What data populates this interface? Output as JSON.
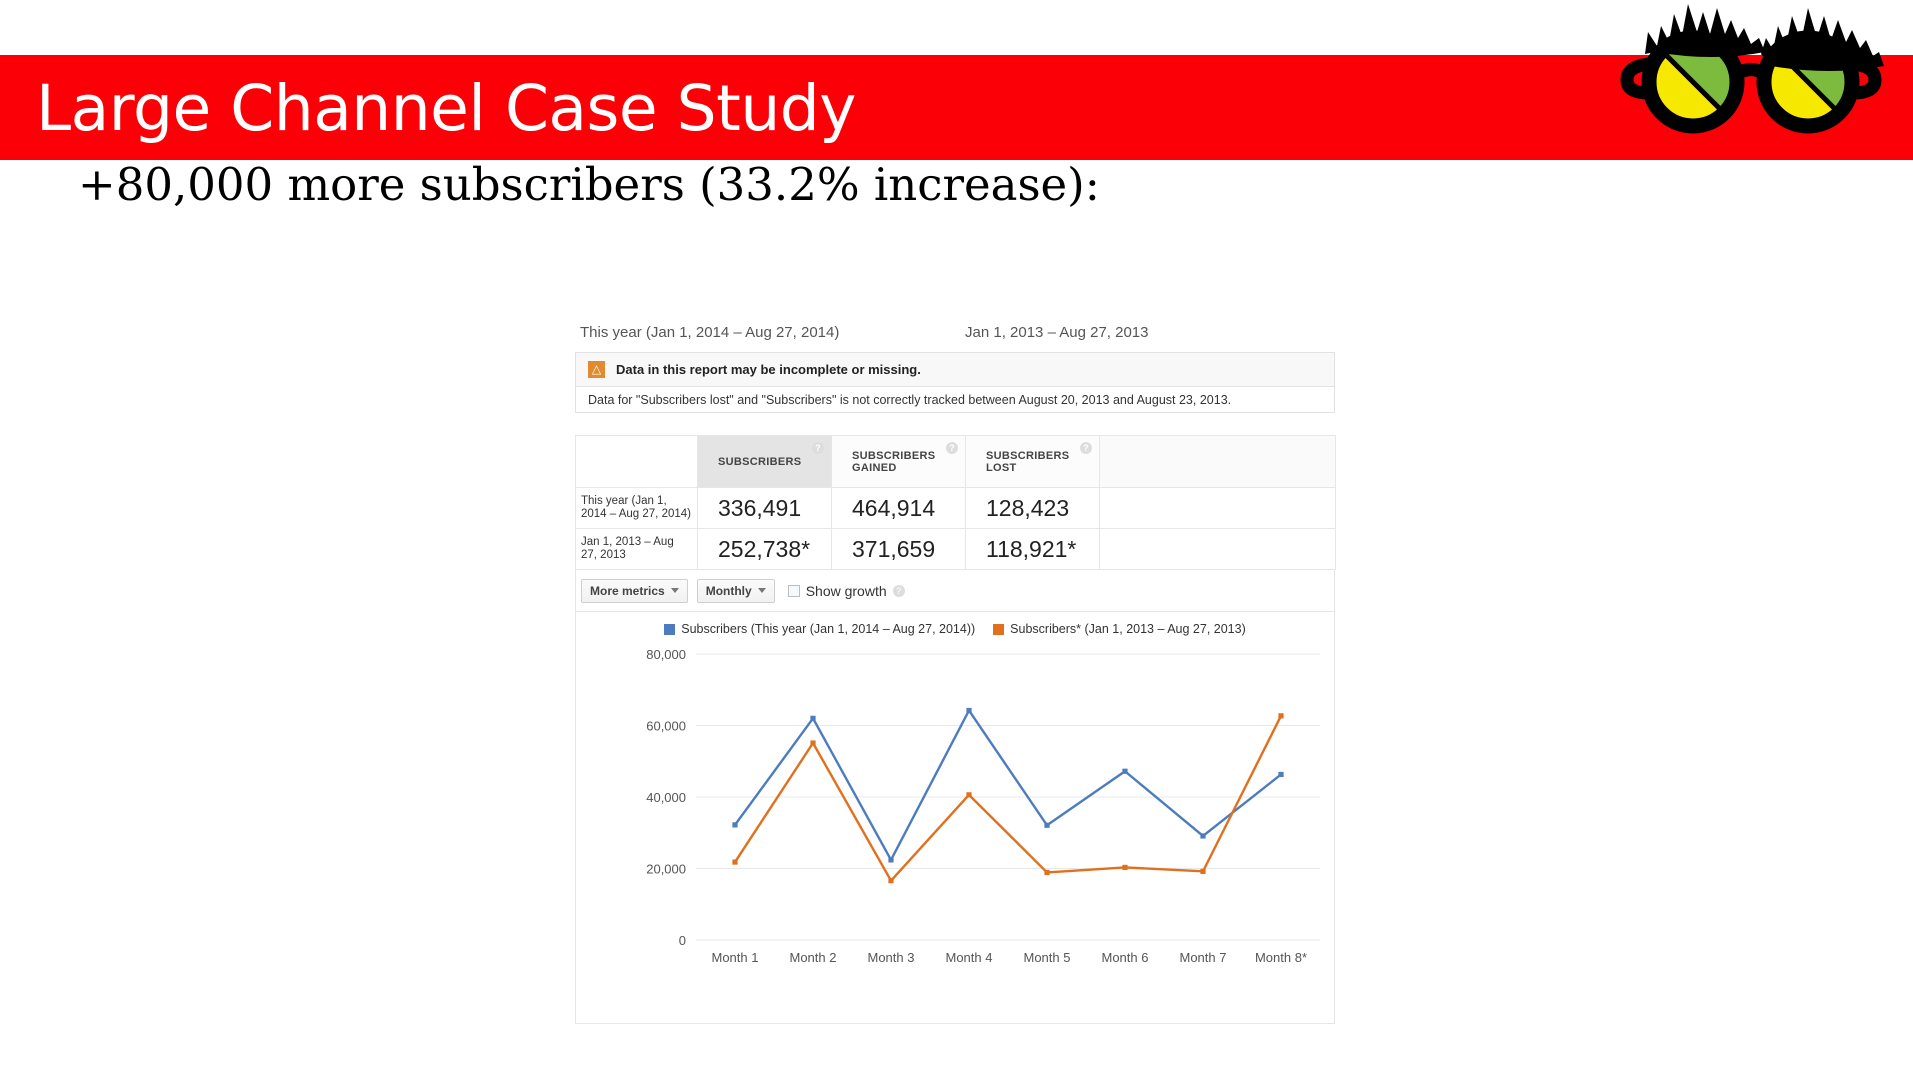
{
  "slide": {
    "title": "Large Channel Case Study",
    "subtitle": "+80,000 more subscribers (33.2% increase):",
    "band_color": "#fb0007",
    "title_color": "#ffffff",
    "logo_name": "glasses-logo",
    "logo_colors": {
      "frame": "#000000",
      "lens_green": "#7dbb3f",
      "lens_yellow": "#f7e800"
    }
  },
  "analytics": {
    "range_current": "This year (Jan 1, 2014 – Aug 27, 2014)",
    "range_previous": "Jan 1, 2013 – Aug 27, 2013",
    "alert": {
      "icon": "warning-triangle-icon",
      "title": "Data in this report may be incomplete or missing.",
      "detail": "Data for \"Subscribers lost\" and \"Subscribers\" is not correctly tracked between August 20, 2013 and August 23, 2013.",
      "icon_color": "#e08b2e"
    },
    "table": {
      "columns": [
        "",
        "SUBSCRIBERS",
        "SUBSCRIBERS GAINED",
        "SUBSCRIBERS LOST",
        ""
      ],
      "columns_line1": [
        "",
        "SUBSCRIBERS",
        "SUBSCRIBERS",
        "SUBSCRIBERS",
        ""
      ],
      "columns_line2": [
        "",
        "",
        "GAINED",
        "LOST",
        ""
      ],
      "selected_column": "SUBSCRIBERS",
      "help_glyph": "?",
      "rows": [
        {
          "label": "This year (Jan 1, 2014 – Aug 27, 2014)",
          "subscribers": "336,491",
          "subscribers_gained": "464,914",
          "subscribers_lost": "128,423"
        },
        {
          "label": "Jan 1, 2013 – Aug 27, 2013",
          "subscribers": "252,738*",
          "subscribers_gained": "371,659",
          "subscribers_lost": "118,921*"
        }
      ]
    },
    "controls": {
      "more_metrics_label": "More metrics",
      "interval_label": "Monthly",
      "show_growth_label": "Show growth",
      "show_growth_checked": false,
      "help_glyph": "?"
    }
  },
  "chart_data": {
    "type": "line",
    "title": "",
    "xlabel": "",
    "ylabel": "",
    "grid": true,
    "legend_position": "top",
    "categories": [
      "Month 1",
      "Month 2",
      "Month 3",
      "Month 4",
      "Month 5",
      "Month 6",
      "Month 7",
      "Month 8*"
    ],
    "ylim": [
      0,
      80000
    ],
    "yticks": [
      0,
      20000,
      40000,
      60000,
      80000
    ],
    "ytick_labels": [
      "0",
      "20,000",
      "40,000",
      "60,000",
      "80,000"
    ],
    "series": [
      {
        "name": "Subscribers (This year (Jan 1, 2014 – Aug 27, 2014))",
        "color": "#4d7cbe",
        "values": [
          32200,
          62000,
          22400,
          64200,
          32100,
          47200,
          29100,
          46300
        ]
      },
      {
        "name": "Subscribers* (Jan 1, 2013 – Aug 27, 2013)",
        "color": "#e0701e",
        "values": [
          21800,
          55100,
          16600,
          40600,
          18900,
          20300,
          19200,
          62700
        ]
      }
    ]
  }
}
